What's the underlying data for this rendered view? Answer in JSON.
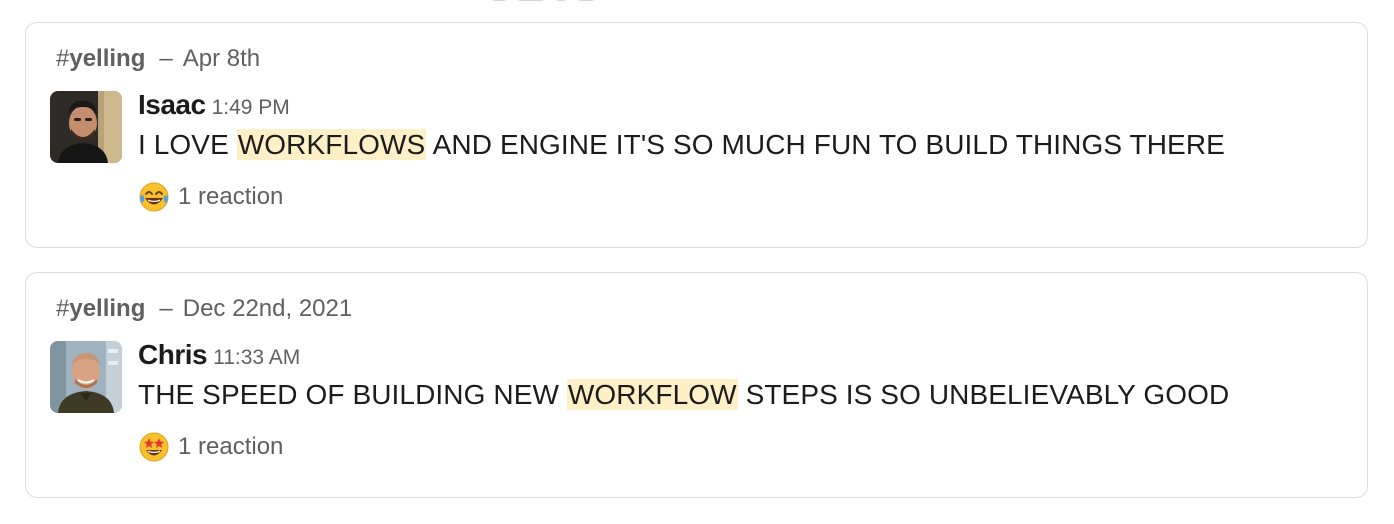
{
  "results": [
    {
      "channel_hash": "#",
      "channel_name": "yelling",
      "separator": "–",
      "date": "Apr 8th",
      "sender": "Isaac",
      "time": "1:49 PM",
      "text_before": "I LOVE ",
      "text_highlight": "WORKFLOWS",
      "text_after": " AND ENGINE IT'S SO MUCH FUN TO BUILD THINGS THERE",
      "reaction_emoji": "face-with-tears-of-joy-icon",
      "reaction_label": "1 reaction"
    },
    {
      "channel_hash": "#",
      "channel_name": "yelling",
      "separator": "–",
      "date": "Dec 22nd, 2021",
      "sender": "Chris",
      "time": "11:33 AM",
      "text_before": "THE SPEED OF BUILDING NEW ",
      "text_highlight": "WORKFLOW",
      "text_after": " STEPS IS SO UNBELIEVABLY GOOD",
      "reaction_emoji": "star-struck-icon",
      "reaction_label": "1 reaction"
    }
  ],
  "colors": {
    "highlight": "#fdefc6",
    "border": "#dcdcdc",
    "muted_text": "#616061",
    "primary_text": "#1d1c1d"
  }
}
